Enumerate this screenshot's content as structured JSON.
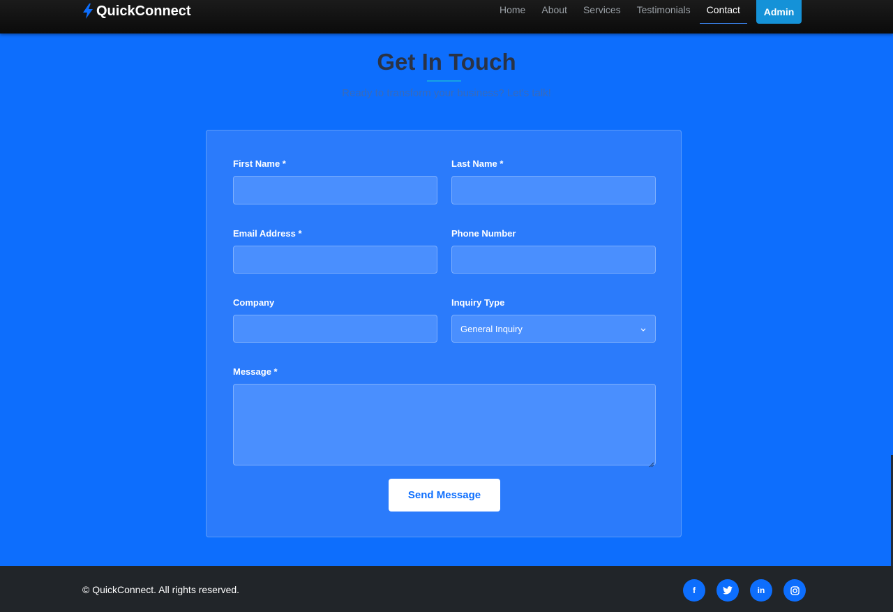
{
  "brand": {
    "name": "QuickConnect",
    "icon": "bolt-icon",
    "icon_color": "#0d6efd"
  },
  "nav": {
    "links": [
      {
        "label": "Home",
        "active": false
      },
      {
        "label": "About",
        "active": false
      },
      {
        "label": "Services",
        "active": false
      },
      {
        "label": "Testimonials",
        "active": false
      },
      {
        "label": "Contact",
        "active": true
      }
    ],
    "admin_label": "Admin"
  },
  "contact": {
    "title": "Get In Touch",
    "subtitle": "Ready to transform your business? Let's talk!",
    "form": {
      "first_name": {
        "label": "First Name *",
        "value": "",
        "placeholder": ""
      },
      "last_name": {
        "label": "Last Name *",
        "value": "",
        "placeholder": ""
      },
      "email": {
        "label": "Email Address *",
        "value": "",
        "placeholder": ""
      },
      "phone": {
        "label": "Phone Number",
        "value": "",
        "placeholder": ""
      },
      "company": {
        "label": "Company",
        "value": "",
        "placeholder": ""
      },
      "inquiry_type": {
        "label": "Inquiry Type",
        "selected": "General Inquiry"
      },
      "message": {
        "label": "Message *",
        "value": "",
        "placeholder": ""
      },
      "submit_label": "Send Message"
    }
  },
  "footer": {
    "copyright": "© QuickConnect. All rights reserved.",
    "social": [
      {
        "name": "facebook-icon",
        "text": "f"
      },
      {
        "name": "twitter-icon",
        "text": ""
      },
      {
        "name": "linkedin-icon",
        "text": "in"
      },
      {
        "name": "instagram-icon",
        "text": ""
      }
    ]
  },
  "colors": {
    "primary": "#0d6efd",
    "accent": "#17a2e3",
    "nav_bg": "#111111",
    "footer_bg": "#212529",
    "card_bg": "#2b7bfb"
  }
}
